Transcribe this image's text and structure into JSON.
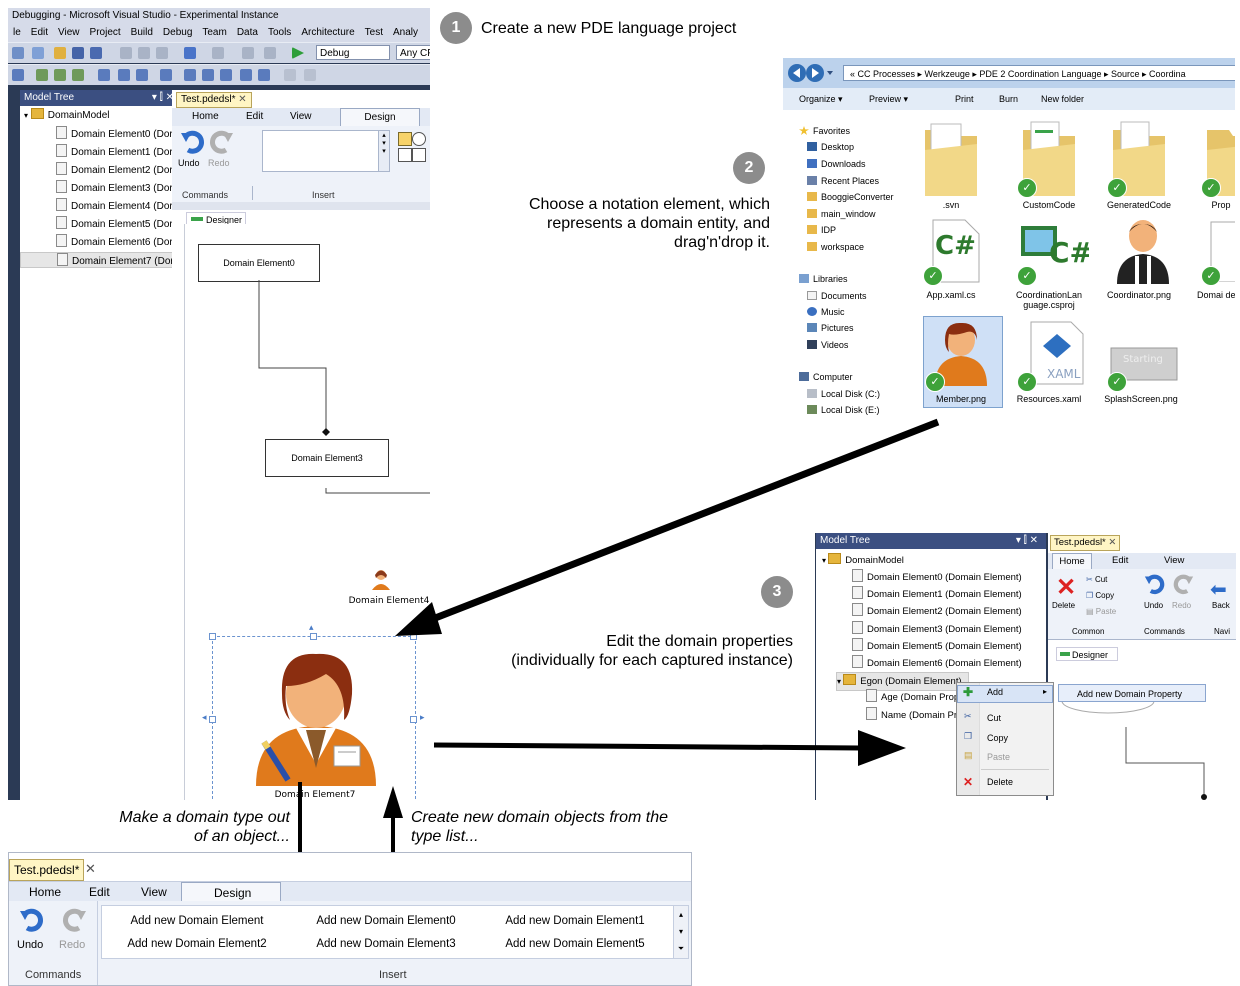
{
  "steps": [
    {
      "number": "1",
      "text": "Create a new PDE language project"
    },
    {
      "number": "2",
      "text_lines": [
        "Choose a notation element, which",
        "represents a domain entity, and",
        "drag'n'drop it."
      ]
    },
    {
      "number": "3",
      "text_lines": [
        "Edit the domain properties",
        "(individually for each captured instance)"
      ]
    }
  ],
  "captions": {
    "make_type_1": "Make a domain type out",
    "make_type_2": "of an object...",
    "create_objects_1": "Create new domain objects from the",
    "create_objects_2": "type list..."
  },
  "vs": {
    "title": "Debugging - Microsoft Visual Studio - Experimental Instance",
    "menu": [
      "le",
      "Edit",
      "View",
      "Project",
      "Build",
      "Debug",
      "Team",
      "Data",
      "Tools",
      "Architecture",
      "Test",
      "Analy"
    ],
    "config": "Debug",
    "platform": "Any CP",
    "model_tree_title": "Model Tree",
    "model_tree_pin": "▾ ⫿ ✕",
    "tree_root": "DomainModel",
    "tree_items": [
      "Domain Element0 (Dor",
      "Domain Element1 (Dor",
      "Domain Element2 (Dor",
      "Domain Element3 (Dor",
      "Domain Element4 (Dor",
      "Domain Element5 (Dor",
      "Domain Element6 (Dor",
      "Domain Element7 (Dor"
    ],
    "doc_tab": "Test.pdedsl*",
    "ribbon_tabs": [
      "Home",
      "Edit",
      "View",
      "Design"
    ],
    "undo": "Undo",
    "redo": "Redo",
    "commands": "Commands",
    "insert": "Insert",
    "designer": "Designer",
    "elements": {
      "e0": "Domain Element0",
      "e3": "Domain Element3",
      "e4": "Domain Element4",
      "e7": "Domain Element7"
    }
  },
  "explorer": {
    "path": "« CC Processes ▸ Werkzeuge ▸ PDE 2 Coordination Language ▸ Source ▸ Coordina",
    "toolbar": [
      "Organize ▾",
      "Preview ▾",
      "Print",
      "Burn",
      "New folder"
    ],
    "nav": [
      "Favorites",
      "Desktop",
      "Downloads",
      "Recent Places",
      "BooggieConverter",
      "main_window",
      "IDP",
      "workspace",
      "Libraries",
      "Documents",
      "Music",
      "Pictures",
      "Videos",
      "Computer",
      "Local Disk (C:)",
      "Local Disk (E:)"
    ],
    "files": [
      ".svn",
      "CustomCode",
      "GeneratedCode",
      "Prop",
      "App.xaml.cs",
      "CoordinationLan guage.csproj",
      "Coordinator.png",
      "Domai del.d",
      "Member.png",
      "Resources.xaml",
      "SplashScreen.png"
    ],
    "xaml_label": "XAML",
    "splash_label": "Starting"
  },
  "shot3": {
    "model_tree_title": "Model Tree",
    "root": "DomainModel",
    "items": [
      "Domain Element0 (Domain Element)",
      "Domain Element1 (Domain Element)",
      "Domain Element2 (Domain Element)",
      "Domain Element3 (Domain Element)",
      "Domain Element5 (Domain Element)",
      "Domain Element6 (Domain Element)",
      "Egon (Domain Element)",
      "Age (Domain Prop",
      "Name (Domain Pr"
    ],
    "doc_tab": "Test.pdedsl*",
    "tabs": [
      "Home",
      "Edit",
      "View"
    ],
    "ribbon": {
      "delete": "Delete",
      "cut": "Cut",
      "copy": "Copy",
      "paste": "Paste",
      "undo": "Undo",
      "redo": "Redo",
      "back": "Back",
      "common": "Common",
      "commands": "Commands",
      "navi": "Navi"
    },
    "designer": "Designer",
    "context_menu": [
      "Add",
      "Cut",
      "Copy",
      "Paste",
      "Delete"
    ],
    "submenu": "Add new Domain Property"
  },
  "bottom_ribbon": {
    "doc_tab": "Test.pdedsl*",
    "tabs": [
      "Home",
      "Edit",
      "View",
      "Design"
    ],
    "undo": "Undo",
    "redo": "Redo",
    "commands": "Commands",
    "insert": "Insert",
    "buttons": [
      "Add new Domain Element",
      "Add new Domain Element0",
      "Add new Domain Element1",
      "Add new Domain Element2",
      "Add new Domain Element3",
      "Add new Domain Element5"
    ]
  }
}
